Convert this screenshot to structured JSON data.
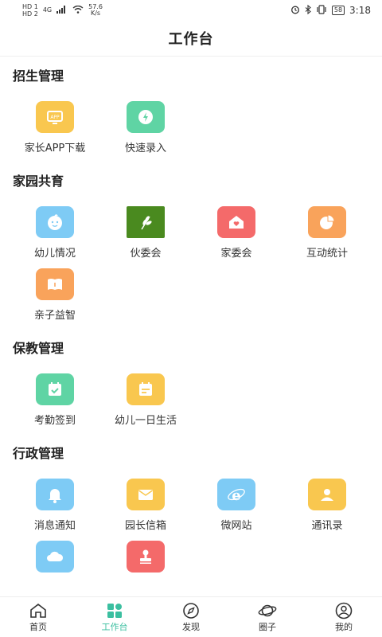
{
  "status": {
    "left_hd1": "HD 1",
    "left_hd2": "HD 2",
    "left_signal": "4G",
    "speed_value": "57.6",
    "speed_unit": "K/s",
    "battery": "58",
    "time": "3:18"
  },
  "header": {
    "title": "工作台"
  },
  "sections": [
    {
      "title": "招生管理",
      "items": [
        {
          "label": "家长APP下载",
          "icon": "app-download-icon",
          "color": "#f9c74f"
        },
        {
          "label": "快速录入",
          "icon": "quick-entry-icon",
          "color": "#5fd4a4"
        }
      ]
    },
    {
      "title": "家园共育",
      "items": [
        {
          "label": "幼儿情况",
          "icon": "child-face-icon",
          "color": "#7ecbf5"
        },
        {
          "label": "伙委会",
          "icon": "wheat-icon",
          "color": "#4a8a1f"
        },
        {
          "label": "家委会",
          "icon": "home-heart-icon",
          "color": "#f46a6a"
        },
        {
          "label": "互动统计",
          "icon": "pie-chart-icon",
          "color": "#f9a35b"
        },
        {
          "label": "亲子益智",
          "icon": "book-icon",
          "color": "#f9a35b"
        }
      ]
    },
    {
      "title": "保教管理",
      "items": [
        {
          "label": "考勤签到",
          "icon": "calendar-check-icon",
          "color": "#5fd4a4"
        },
        {
          "label": "幼儿一日生活",
          "icon": "schedule-icon",
          "color": "#f9c74f"
        }
      ]
    },
    {
      "title": "行政管理",
      "items": [
        {
          "label": "消息通知",
          "icon": "bell-icon",
          "color": "#7ecbf5"
        },
        {
          "label": "园长信箱",
          "icon": "mail-icon",
          "color": "#f9c74f"
        },
        {
          "label": "微网站",
          "icon": "ie-icon",
          "color": "#7ecbf5"
        },
        {
          "label": "通讯录",
          "icon": "contacts-icon",
          "color": "#f9c74f"
        },
        {
          "label": "",
          "icon": "cloud-icon",
          "color": "#7ecbf5"
        },
        {
          "label": "",
          "icon": "stamp-icon",
          "color": "#f46a6a"
        }
      ]
    }
  ],
  "tabs": [
    {
      "label": "首页",
      "icon": "home-icon"
    },
    {
      "label": "工作台",
      "icon": "workbench-icon",
      "active": true
    },
    {
      "label": "发现",
      "icon": "compass-icon"
    },
    {
      "label": "圈子",
      "icon": "planet-icon"
    },
    {
      "label": "我的",
      "icon": "user-icon"
    }
  ],
  "colors": {
    "accent": "#3bbfa0"
  }
}
